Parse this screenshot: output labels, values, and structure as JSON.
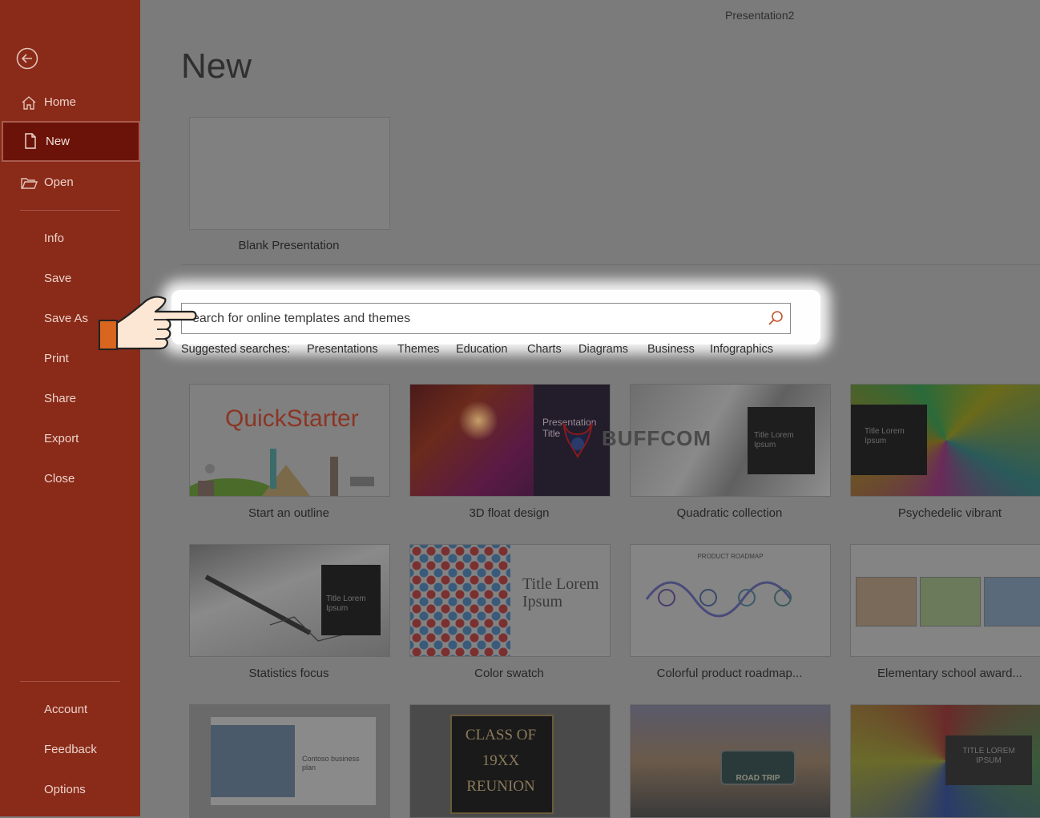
{
  "window": {
    "doc_title": "Presentation2"
  },
  "sidebar": {
    "items_top": [
      {
        "label": "Home",
        "icon": "home-icon"
      },
      {
        "label": "New",
        "icon": "new-file-icon",
        "active": true
      },
      {
        "label": "Open",
        "icon": "folder-open-icon"
      }
    ],
    "items_mid": [
      "Info",
      "Save",
      "Save As",
      "Print",
      "Share",
      "Export",
      "Close"
    ],
    "items_bottom": [
      "Account",
      "Feedback",
      "Options"
    ]
  },
  "main": {
    "heading": "New",
    "blank_label": "Blank Presentation",
    "search": {
      "text": "earch for online templates and themes"
    },
    "suggested": {
      "heading": "Suggested searches:",
      "items": [
        "Presentations",
        "Themes",
        "Education",
        "Charts",
        "Diagrams",
        "Business",
        "Infographics"
      ]
    },
    "templates": [
      {
        "label": "Start an outline",
        "thumb_text": "QuickStarter"
      },
      {
        "label": "3D float design",
        "thumb_text": "Presentation Title"
      },
      {
        "label": "Quadratic collection",
        "thumb_text": "Title Lorem Ipsum"
      },
      {
        "label": "Psychedelic vibrant",
        "thumb_text": "Title Lorem Ipsum"
      },
      {
        "label": "Statistics focus",
        "thumb_text": "Title Lorem Ipsum"
      },
      {
        "label": "Color swatch",
        "thumb_text": "Title Lorem Ipsum"
      },
      {
        "label": "Colorful product roadmap...",
        "thumb_text": "PRODUCT ROADMAP"
      },
      {
        "label": "Elementary school award...",
        "thumb_text": ""
      },
      {
        "label": "",
        "thumb_text": "Contoso business plan"
      },
      {
        "label": "",
        "thumb_text": "CLASS OF 19XX REUNION"
      },
      {
        "label": "",
        "thumb_text": "ROAD TRIP"
      },
      {
        "label": "",
        "thumb_text": "TITLE LOREM IPSUM"
      }
    ]
  },
  "watermark": {
    "text": "BUFFCOM"
  },
  "colors": {
    "sidebar_bg": "#8a2a18",
    "active_bg": "#6c1309",
    "overlay_gray": "#7b7b7b"
  }
}
